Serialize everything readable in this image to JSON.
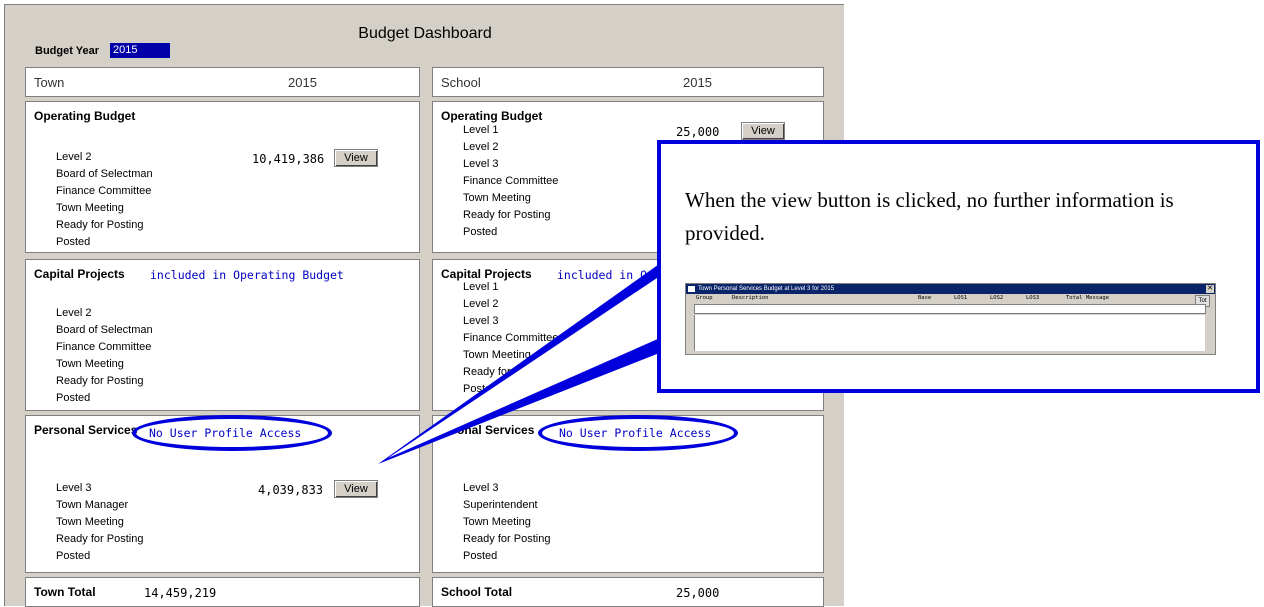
{
  "dashboard": {
    "title": "Budget Dashboard",
    "budget_year_label": "Budget Year",
    "budget_year_value": "2015"
  },
  "town": {
    "name": "Town",
    "year": "2015",
    "operating": {
      "title": "Operating Budget",
      "rows": [
        "Level 2",
        "Board of Selectman",
        "Finance Committee",
        "Town Meeting",
        "Ready for Posting",
        "Posted"
      ],
      "amount": "10,419,386",
      "view_label": "View"
    },
    "capital": {
      "title": "Capital Projects",
      "note": "included in Operating Budget",
      "rows": [
        "Level 2",
        "Board of Selectman",
        "Finance Committee",
        "Town Meeting",
        "Ready for Posting",
        "Posted"
      ]
    },
    "personal": {
      "title": "Personal Services",
      "note": "No User Profile Access",
      "rows": [
        "Level 3",
        "Town Manager",
        "Town Meeting",
        "Ready for Posting",
        "Posted"
      ],
      "amount": "4,039,833",
      "view_label": "View"
    },
    "total_label": "Town Total",
    "total_value": "14,459,219"
  },
  "school": {
    "name": "School",
    "year": "2015",
    "operating": {
      "title": "Operating Budget",
      "rows": [
        "Level 1",
        "Level 2",
        "Level 3",
        "Finance Committee",
        "Town Meeting",
        "Ready for Posting",
        "Posted"
      ],
      "amount": "25,000",
      "view_label": "View"
    },
    "capital": {
      "title": "Capital Projects",
      "note": "included in Op",
      "rows": [
        "Level 1",
        "Level 2",
        "Level 3",
        "Finance Committee",
        "Town Meeting",
        "Ready for Po",
        "Posted"
      ]
    },
    "personal": {
      "title": "onal Services",
      "note": "No User Profile Access",
      "rows": [
        "Level 3",
        "Superintendent",
        "Town Meeting",
        "Ready for Posting",
        "Posted"
      ]
    },
    "total_label": "School Total",
    "total_value": "25,000"
  },
  "callout": {
    "text": "When the view button is clicked, no further information is provided.",
    "mini_window": {
      "title": "Town Personal Services Budget at Level 3 for 2015",
      "columns": [
        "Group",
        "Description",
        "Base",
        "LOS1",
        "LOS2",
        "LOS3",
        "Total Message"
      ],
      "tot_label": "Tot"
    }
  },
  "colors": {
    "annotation": "#0000dd",
    "note_text": "#0000c0",
    "panel": "#d4d0c8"
  }
}
